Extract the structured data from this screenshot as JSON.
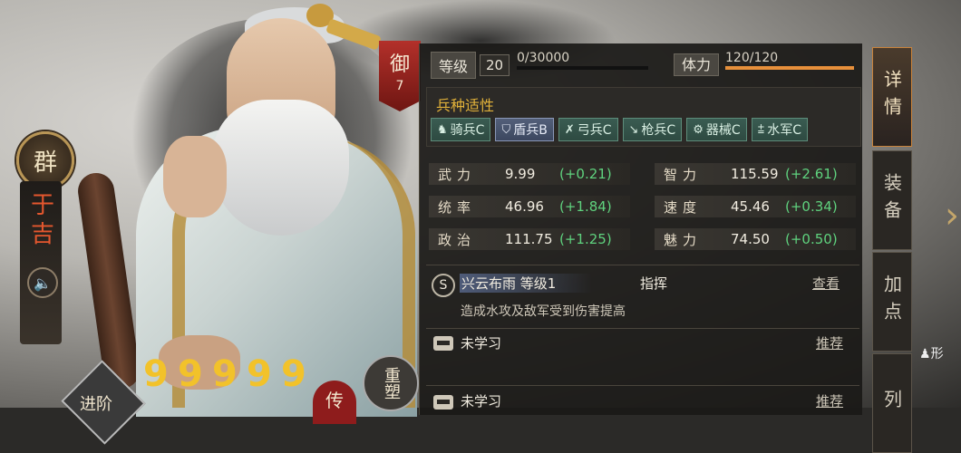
{
  "general": {
    "faction": "群",
    "name": "于吉",
    "title_short": "御",
    "title_level": "7"
  },
  "level": {
    "label": "等级",
    "value": "20",
    "exp": "0/30000",
    "exp_progress": 0
  },
  "stamina": {
    "label": "体力",
    "value": "120/120",
    "progress": 1.0
  },
  "affinity": {
    "title": "兵种适性",
    "items": [
      {
        "icon": "horse-icon",
        "label": "骑兵C"
      },
      {
        "icon": "shield-icon",
        "label": "盾兵B"
      },
      {
        "icon": "bow-icon",
        "label": "弓兵C"
      },
      {
        "icon": "spear-icon",
        "label": "枪兵C"
      },
      {
        "icon": "gear-icon",
        "label": "器械C"
      },
      {
        "icon": "boat-icon",
        "label": "水军C"
      }
    ]
  },
  "stats": [
    {
      "name": "武力",
      "value": "9.99",
      "bonus": "(+0.21)"
    },
    {
      "name": "智力",
      "value": "115.59",
      "bonus": "(+2.61)"
    },
    {
      "name": "统率",
      "value": "46.96",
      "bonus": "(+1.84)"
    },
    {
      "name": "速度",
      "value": "45.46",
      "bonus": "(+0.34)"
    },
    {
      "name": "政治",
      "value": "111.75",
      "bonus": "(+1.25)"
    },
    {
      "name": "魅力",
      "value": "74.50",
      "bonus": "(+0.50)"
    }
  ],
  "skill": {
    "badge": "S",
    "name": "兴云布雨 等级1",
    "type": "指挥",
    "view": "查看",
    "desc": "造成水攻及敌军受到伤害提高"
  },
  "slots": [
    {
      "label": "未学习",
      "action": "推荐"
    },
    {
      "label": "未学习",
      "action": "推荐"
    }
  ],
  "buttons": {
    "advance": "进阶",
    "reshape": "重塑",
    "biography": "传"
  },
  "awaken_count": 5,
  "tabs": [
    "详情",
    "装备",
    "加点",
    "列"
  ],
  "side_label": "形"
}
